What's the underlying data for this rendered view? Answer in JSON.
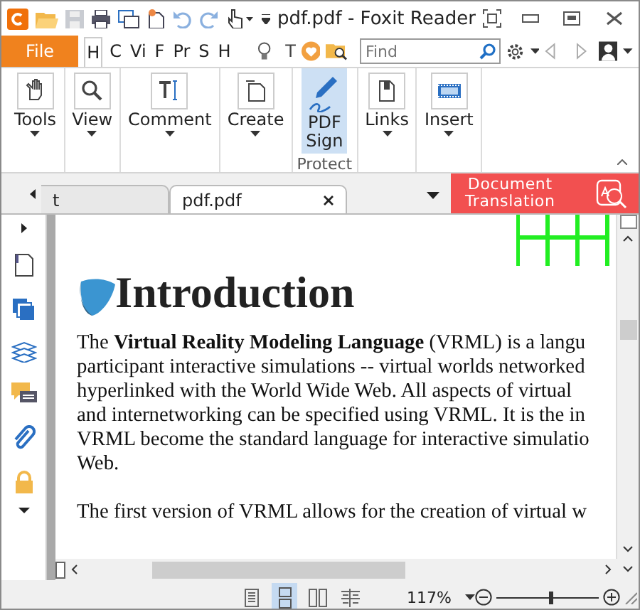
{
  "window": {
    "title": "pdf.pdf - Foxit Reader"
  },
  "menu_tabs": [
    {
      "label": "File",
      "kind": "file",
      "selected": false
    },
    {
      "label": "H",
      "kind": "tab",
      "selected": true
    },
    {
      "label": "C",
      "kind": "tab",
      "selected": false
    },
    {
      "label": "Vi",
      "kind": "tab",
      "selected": false
    },
    {
      "label": "F",
      "kind": "tab",
      "selected": false
    },
    {
      "label": "Pr",
      "kind": "tab",
      "selected": false
    },
    {
      "label": "S",
      "kind": "tab",
      "selected": false
    },
    {
      "label": "H",
      "kind": "tab",
      "selected": false
    }
  ],
  "menu_tools": [
    "T"
  ],
  "search": {
    "placeholder": "Find"
  },
  "ribbon": {
    "buttons": [
      {
        "label": "Tools",
        "kind": "hand",
        "dropdown": true,
        "selected": false
      },
      {
        "label": "View",
        "kind": "zoom",
        "dropdown": true,
        "selected": false
      },
      {
        "label": "Comment",
        "kind": "text",
        "dropdown": true,
        "selected": false
      },
      {
        "label": "Create",
        "kind": "page",
        "dropdown": true,
        "selected": false
      },
      {
        "label": "PDF Sign",
        "kind": "pen",
        "dropdown": false,
        "selected": true,
        "group": "Protect"
      },
      {
        "label": "Links",
        "kind": "link",
        "dropdown": true,
        "selected": false
      },
      {
        "label": "Insert",
        "kind": "film",
        "dropdown": true,
        "selected": false
      }
    ]
  },
  "doc_tabs": [
    {
      "label": "t",
      "selected": false
    },
    {
      "label": "pdf.pdf",
      "selected": true
    }
  ],
  "banner": {
    "label": "Document Translation"
  },
  "document": {
    "heading": "Introduction",
    "paragraphs": [
      [
        "The **Virtual Reality Modeling Language** (VRML) is a langu",
        "participant interactive simulations -- virtual worlds networked",
        "hyperlinked with the World Wide Web. All aspects of virtual",
        "and internetworking can be specified using VRML. It is the in",
        "VRML become the standard language for interactive simulatio",
        "Web."
      ],
      [
        "The first version of VRML allows for the creation of virtual w"
      ]
    ]
  },
  "status_bar": {
    "views": [
      {
        "kind": "single",
        "selected": false
      },
      {
        "kind": "continuous",
        "selected": true
      },
      {
        "kind": "facing",
        "selected": false
      },
      {
        "kind": "cover",
        "selected": false
      }
    ],
    "zoom": "117%",
    "zoom_slider": {
      "level": 0.52
    }
  }
}
